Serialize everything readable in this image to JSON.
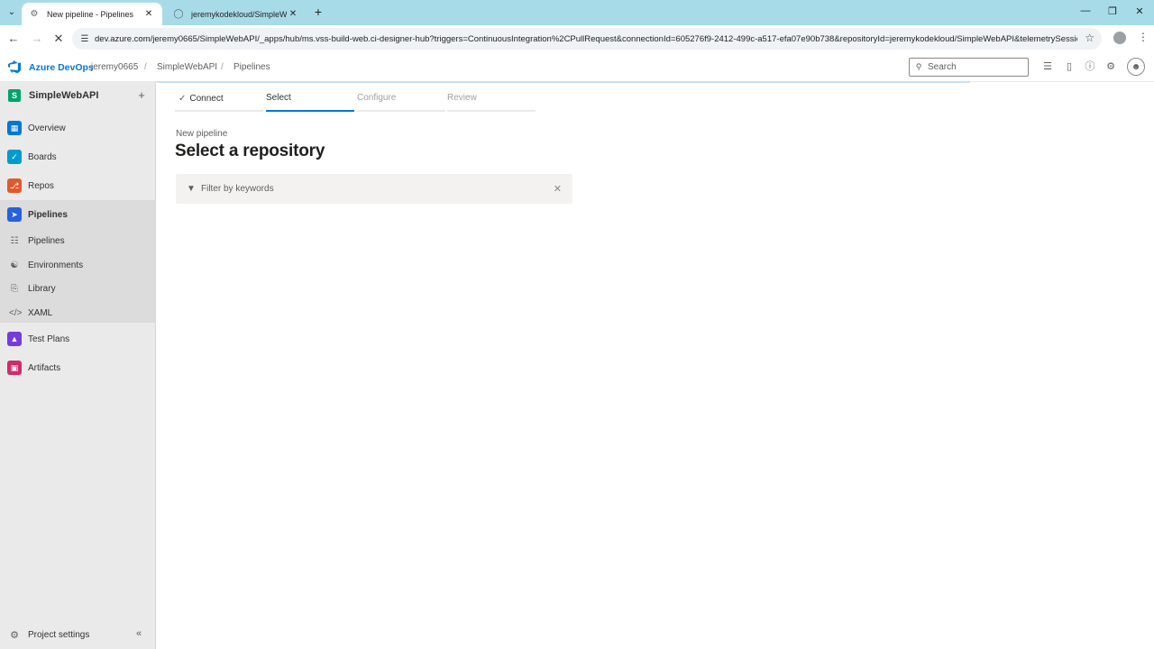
{
  "browser": {
    "tabs": [
      {
        "title": "New pipeline - Pipelines",
        "active": true
      },
      {
        "title": "jeremykodekloud/SimpleWebA",
        "active": false
      }
    ],
    "url": "dev.azure.com/jeremy0665/SimpleWebAPI/_apps/hub/ms.vss-build-web.ci-designer-hub?triggers=ContinuousIntegration%2CPullRequest&connectionId=605276f9-2412-499c-a517-efa07e90b738&repositoryId=jeremykodekloud/SimpleWebAPI&telemetrySession..."
  },
  "header": {
    "brand": "Azure DevOps",
    "breadcrumbs": [
      "jeremy0665",
      "SimpleWebAPI",
      "Pipelines"
    ],
    "search_placeholder": "Search"
  },
  "sidebar": {
    "project_name": "SimpleWebAPI",
    "project_initial": "S",
    "items": [
      {
        "label": "Overview",
        "color": "#0078d4"
      },
      {
        "label": "Boards",
        "color": "#009ccc"
      },
      {
        "label": "Repos",
        "color": "#e05a2c"
      },
      {
        "label": "Pipelines",
        "color": "#2560e0"
      }
    ],
    "sub_items": [
      {
        "label": "Pipelines"
      },
      {
        "label": "Environments"
      },
      {
        "label": "Library"
      },
      {
        "label": "XAML"
      }
    ],
    "bottom_items": [
      {
        "label": "Test Plans",
        "color": "#773adc"
      },
      {
        "label": "Artifacts",
        "color": "#cb2e6d"
      }
    ],
    "settings_label": "Project settings"
  },
  "wizard": {
    "steps": [
      {
        "label": "Connect",
        "state": "done"
      },
      {
        "label": "Select",
        "state": "current"
      },
      {
        "label": "Configure",
        "state": "pending"
      },
      {
        "label": "Review",
        "state": "pending"
      }
    ]
  },
  "main": {
    "subtitle": "New pipeline",
    "title": "Select a repository",
    "filter_placeholder": "Filter by keywords"
  },
  "colors": {
    "accent": "#0078d4",
    "tabbar": "#a8dbe8"
  }
}
